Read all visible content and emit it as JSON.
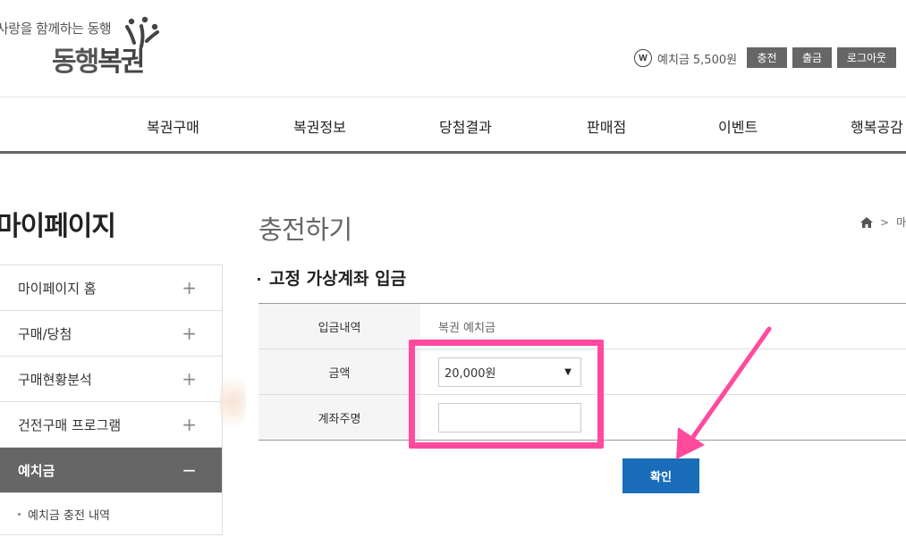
{
  "header": {
    "slogan": "사랑을 함께하는 동행",
    "logo": {
      "part1": "동행",
      "part2": "복권"
    },
    "currency_icon": "W",
    "balance_label": "예치금",
    "balance_amount": "5,500원",
    "buttons": {
      "charge": "충전",
      "withdraw": "출금",
      "logout": "로그아웃"
    }
  },
  "nav": {
    "items": [
      "복권구매",
      "복권정보",
      "당첨결과",
      "판매점",
      "이벤트",
      "행복공감"
    ]
  },
  "sidebar": {
    "title": "마이페이지",
    "items": [
      {
        "label": "마이페이지 홈",
        "toggle": "+"
      },
      {
        "label": "구매/당첨",
        "toggle": "+"
      },
      {
        "label": "구매현황분석",
        "toggle": "+"
      },
      {
        "label": "건전구매 프로그램",
        "toggle": "+"
      },
      {
        "label": "예치금",
        "toggle": "−"
      }
    ],
    "sub_items": [
      "예치금 충전 내역"
    ]
  },
  "main": {
    "page_title": "충전하기",
    "breadcrumb": {
      "separator": ">",
      "current": "마"
    },
    "section_title": "고정 가상계좌 입금",
    "form": {
      "rows": [
        {
          "label": "입금내역",
          "value": "복권 예치금"
        },
        {
          "label": "금액",
          "selected": "20,000원"
        },
        {
          "label": "계좌주명",
          "value": ""
        }
      ]
    },
    "confirm_label": "확인"
  },
  "colors": {
    "highlight": "#ff4a9e",
    "primary_button": "#1a6db8",
    "sidebar_active": "#666666",
    "header_button": "#666666"
  },
  "icons": [
    "people-logo-icon",
    "won-icon",
    "home-icon",
    "plus-icon",
    "minus-icon",
    "caret-down-icon",
    "arrow-annotation-icon"
  ]
}
